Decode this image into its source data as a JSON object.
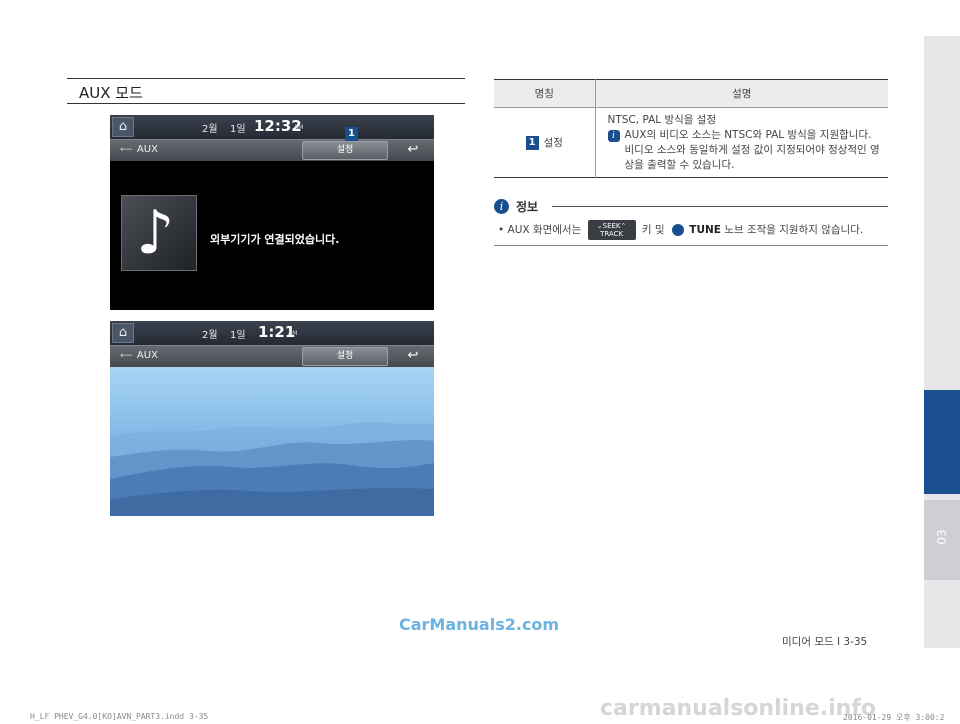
{
  "section": {
    "title": "AUX 모드"
  },
  "screen1": {
    "month": "2월",
    "day": "1일",
    "time": "12:32",
    "ampm": "AM",
    "source": "AUX",
    "settings_button": "설정",
    "back_icon": "back-arrow-icon",
    "message": "외부기기가 연결되었습니다.",
    "marker": "1"
  },
  "screen2": {
    "month": "2월",
    "day": "1일",
    "time": "1:21",
    "ampm": "AM",
    "source": "AUX",
    "settings_button": "설정"
  },
  "table": {
    "header_name": "명칭",
    "header_desc": "설명",
    "row": {
      "marker": "1",
      "name": "설정",
      "line1": "NTSC, PAL 방식을 설정",
      "note": "AUX의 비디오 소스는 NTSC와 PAL 방식을 지원합니다. 비디오 소스와 동일하게 설정 값이 지정되어야 정상적인 영상을 출력할 수 있습니다."
    }
  },
  "info": {
    "label": "정보",
    "text_before": "• AUX 화면에서는",
    "seek_top": "SEEK",
    "seek_bottom": "TRACK",
    "text_middle": "키 및",
    "tune": "TUNE",
    "text_after": "노브 조작을 지원하지 않습니다."
  },
  "sidebar": {
    "chapter": "03",
    "accent_color": "#1a4f8f"
  },
  "watermark": "CarManuals2.com",
  "page_number": "미디어 모드 I 3-35",
  "footer_left": "H_LF PHEV_G4.0[KO]AVN_PART3.indd   3-35",
  "footer_right": "2016-01-29  오후 3:00:2",
  "site_watermark": "carmanualsonline.info"
}
